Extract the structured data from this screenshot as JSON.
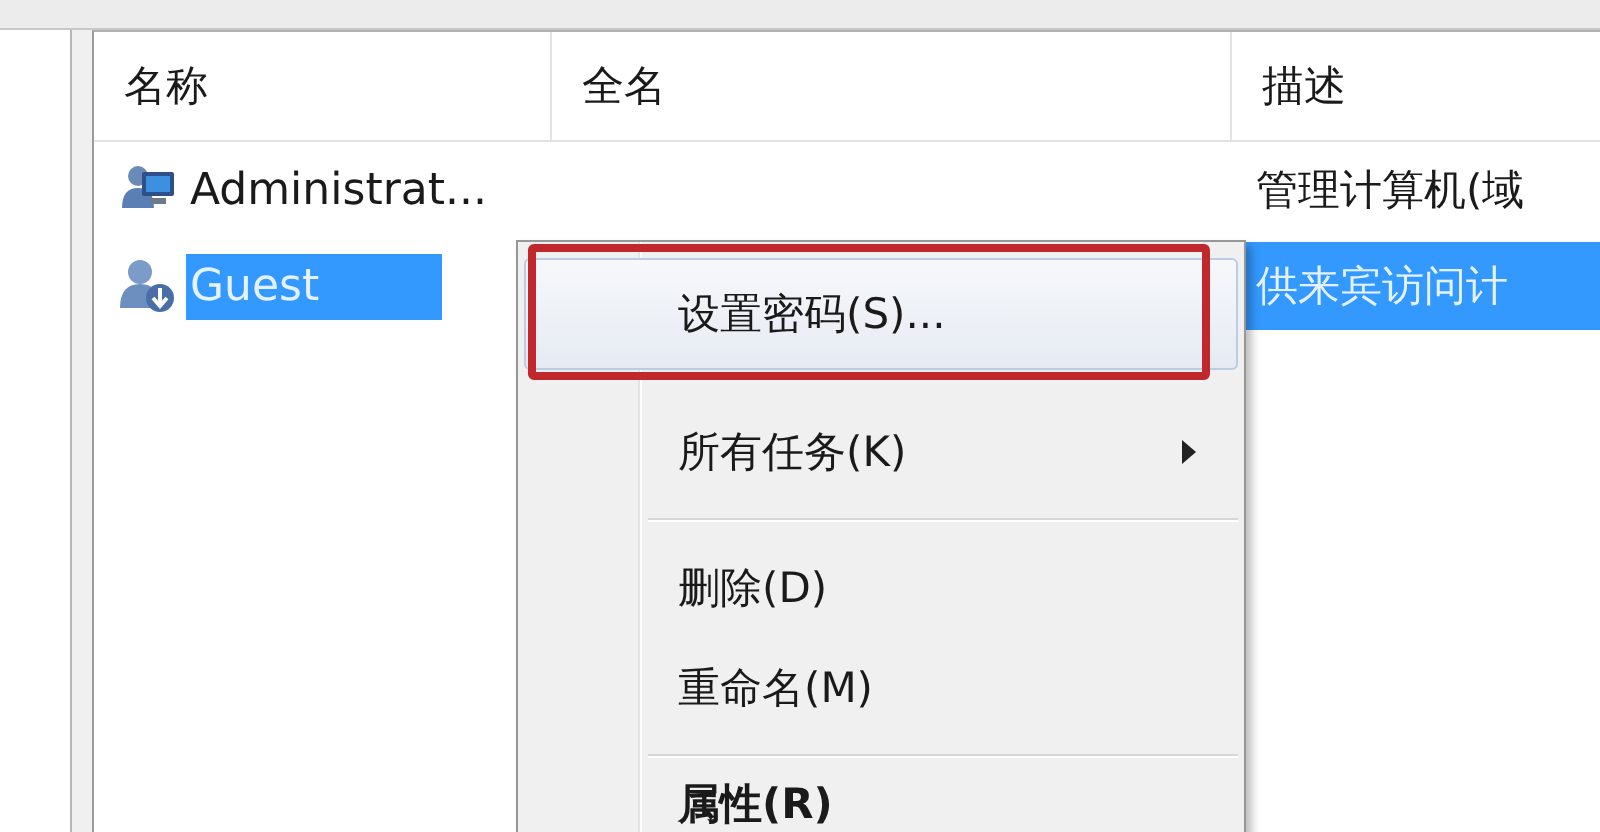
{
  "columns": [
    {
      "label": "名称"
    },
    {
      "label": "全名"
    },
    {
      "label": "描述"
    }
  ],
  "rows": [
    {
      "kind": "admin",
      "name": "Administrat...",
      "description": "管理计算机(域",
      "selected": false
    },
    {
      "kind": "guest",
      "name": "Guest",
      "description": "供来宾访问计",
      "selected": true
    }
  ],
  "context_menu": {
    "items": [
      {
        "kind": "item",
        "label": "设置密码(S)...",
        "selected": true,
        "framed": true,
        "submenu": false,
        "bold": false
      },
      {
        "kind": "item",
        "label": "所有任务(K)",
        "selected": false,
        "framed": false,
        "submenu": true,
        "bold": false
      },
      {
        "kind": "separator"
      },
      {
        "kind": "item",
        "label": "删除(D)",
        "selected": false,
        "framed": false,
        "submenu": false,
        "bold": false
      },
      {
        "kind": "item",
        "label": "重命名(M)",
        "selected": false,
        "framed": false,
        "submenu": false,
        "bold": false
      },
      {
        "kind": "separator"
      },
      {
        "kind": "item",
        "label": "属性(R)",
        "selected": false,
        "framed": false,
        "submenu": false,
        "bold": true
      }
    ]
  }
}
